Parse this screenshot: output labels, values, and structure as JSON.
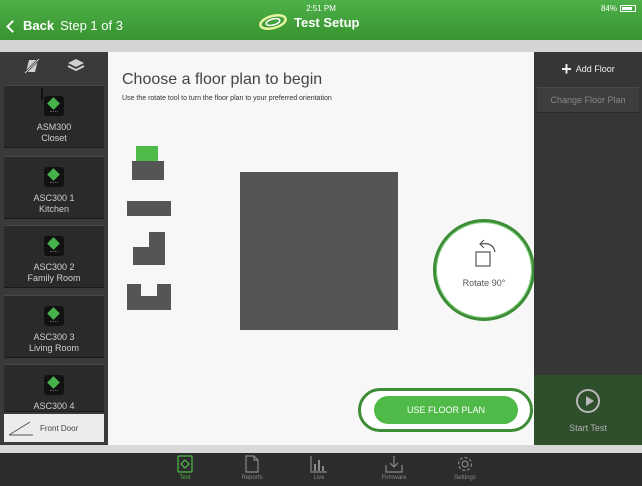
{
  "header": {
    "back_label": "Back",
    "step_label": "Step 1 of 3",
    "time": "2:51 PM",
    "title": "Test Setup",
    "battery": "84%"
  },
  "left_sidebar": {
    "devices": [
      {
        "name": "ASM300",
        "location": "Closet"
      },
      {
        "name": "ASC300 1",
        "location": "Kitchen"
      },
      {
        "name": "ASC300 2",
        "location": "Family Room"
      },
      {
        "name": "ASC300 3",
        "location": "Living Room"
      },
      {
        "name": "ASC300 4",
        "location": ""
      }
    ],
    "front_door_label": "Front Door"
  },
  "main": {
    "heading": "Choose a floor plan to begin",
    "subheading": "Use the rotate tool to turn the floor plan to your preferred orientation",
    "rotate_label": "Rotate 90°",
    "use_button": "USE FLOOR PLAN"
  },
  "right_sidebar": {
    "add_floor": "Add Floor",
    "change_floor_plan": "Change Floor Plan",
    "start_test": "Start Test"
  },
  "tabs": [
    {
      "label": "Test",
      "active": true
    },
    {
      "label": "Reports",
      "active": false
    },
    {
      "label": "Live",
      "active": false
    },
    {
      "label": "Firmware",
      "active": false
    },
    {
      "label": "Settings",
      "active": false
    }
  ],
  "colors": {
    "accent": "#4fba47",
    "header_green": "#3c9a34",
    "dark_panel": "#363636"
  }
}
